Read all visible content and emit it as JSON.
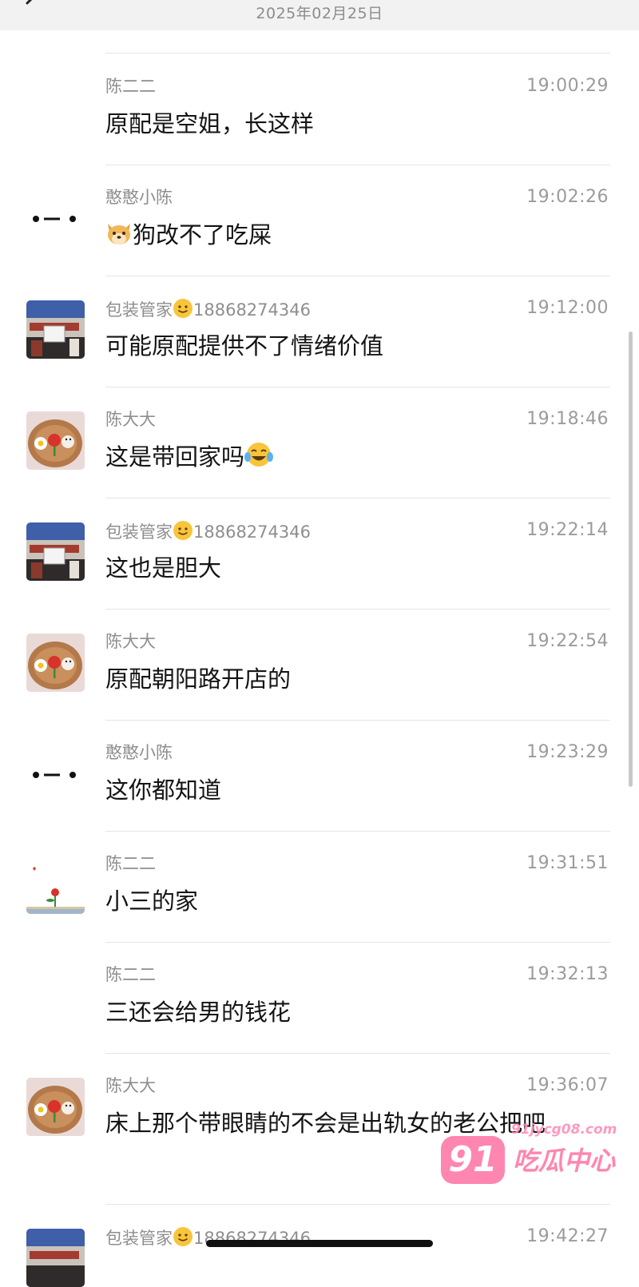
{
  "header": {
    "date": "2025年02月25日",
    "back_icon": "chevron-left-icon"
  },
  "messages": [
    {
      "sender": "陈二二",
      "time": "19:00:29",
      "text": "原配是空姐，长这样",
      "avatar": "none"
    },
    {
      "sender": "憨憨小陈",
      "time": "19:02:26",
      "text": "狗改不了吃屎",
      "avatar": "dots",
      "leading_emoji": "dog-face-emoji"
    },
    {
      "sender": "包装管家",
      "sender_suffix": "18868274346",
      "time": "19:12:00",
      "text": "可能原配提供不了情绪价值",
      "avatar": "palace",
      "sender_emoji": "smile-emoji"
    },
    {
      "sender": "陈大大",
      "time": "19:18:46",
      "text": "这是带回家吗",
      "avatar": "flowers",
      "trailing_emoji": "tears-of-joy-emoji"
    },
    {
      "sender": "包装管家",
      "sender_suffix": "18868274346",
      "time": "19:22:14",
      "text": "这也是胆大",
      "avatar": "palace",
      "sender_emoji": "smile-emoji"
    },
    {
      "sender": "陈大大",
      "time": "19:22:54",
      "text": "原配朝阳路开店的",
      "avatar": "flowers"
    },
    {
      "sender": "憨憨小陈",
      "time": "19:23:29",
      "text": "这你都知道",
      "avatar": "dots"
    },
    {
      "sender": "陈二二",
      "time": "19:31:51",
      "text": "小三的家",
      "avatar": "rose"
    },
    {
      "sender": "陈二二",
      "time": "19:32:13",
      "text": "三还会给男的钱花",
      "avatar": "none"
    },
    {
      "sender": "陈大大",
      "time": "19:36:07",
      "text": "床上那个带眼睛的不会是出轨女的老公把吧",
      "avatar": "flowers"
    },
    {
      "sender": "包装管家",
      "sender_suffix": "18868274346",
      "time": "19:42:27",
      "text": "",
      "avatar": "palace",
      "sender_emoji": "smile-emoji"
    }
  ],
  "watermark": {
    "url": "91jycg08.com",
    "number": "91",
    "name": "吃瓜中心"
  },
  "colors": {
    "background": "#ffffff",
    "topbar": "#f2f2f2",
    "divider": "#e5e5e5",
    "meta_text": "#8e8e8e",
    "message_text": "#141414",
    "watermark": "#ff7aa8"
  }
}
